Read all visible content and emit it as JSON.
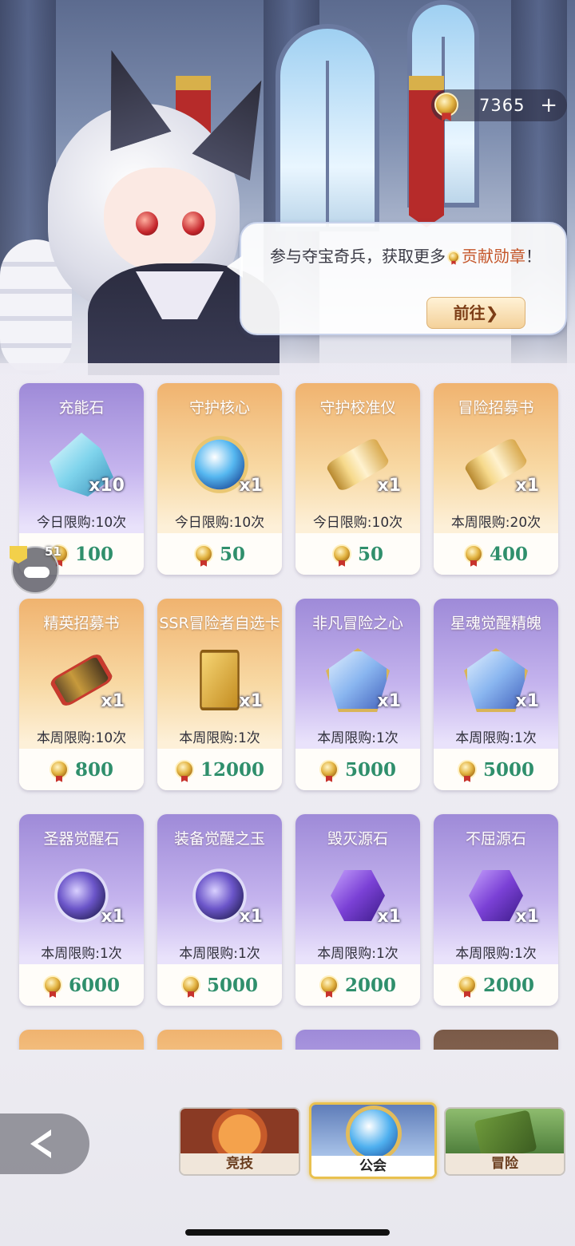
{
  "currency": {
    "icon": "contribution-medal-icon",
    "amount": "7365",
    "plus": "+"
  },
  "dialog": {
    "text_before": "参与夺宝奇兵，获取更多",
    "highlight": "贡献勋章",
    "text_after": "！",
    "button": "前往",
    "button_arrow": "❯"
  },
  "side": {
    "count": "51"
  },
  "items": [
    {
      "name": "充能石",
      "qty": "x10",
      "limit": "今日限购:10次",
      "price": "100",
      "theme": "purple",
      "icon": "crystal-icon"
    },
    {
      "name": "守护核心",
      "qty": "x1",
      "limit": "今日限购:10次",
      "price": "50",
      "theme": "orange",
      "icon": "orb-icon"
    },
    {
      "name": "守护校准仪",
      "qty": "x1",
      "limit": "今日限购:10次",
      "price": "50",
      "theme": "orange",
      "icon": "scroll-icon"
    },
    {
      "name": "冒险招募书",
      "qty": "x1",
      "limit": "本周限购:20次",
      "price": "400",
      "theme": "orange",
      "icon": "scroll-icon"
    },
    {
      "name": "精英招募书",
      "qty": "x1",
      "limit": "本周限购:10次",
      "price": "800",
      "theme": "orange",
      "icon": "red-scroll-icon"
    },
    {
      "name": "SSR冒险者自选卡",
      "qty": "x1",
      "limit": "本周限购:1次",
      "price": "12000",
      "theme": "orange",
      "icon": "card-icon"
    },
    {
      "name": "非凡冒险之心",
      "qty": "x1",
      "limit": "本周限购:1次",
      "price": "5000",
      "theme": "purple",
      "icon": "heart-badge-icon"
    },
    {
      "name": "星魂觉醒精魄",
      "qty": "x1",
      "limit": "本周限购:1次",
      "price": "5000",
      "theme": "purple",
      "icon": "badge-icon"
    },
    {
      "name": "圣器觉醒石",
      "qty": "x1",
      "limit": "本周限购:1次",
      "price": "6000",
      "theme": "purple",
      "icon": "galaxy-orb-icon"
    },
    {
      "name": "装备觉醒之玉",
      "qty": "x1",
      "limit": "本周限购:1次",
      "price": "5000",
      "theme": "purple",
      "icon": "jade-orb-icon"
    },
    {
      "name": "毁灭源石",
      "qty": "x1",
      "limit": "本周限购:1次",
      "price": "2000",
      "theme": "purple",
      "icon": "hex-stone-icon"
    },
    {
      "name": "不屈源石",
      "qty": "x1",
      "limit": "本周限购:1次",
      "price": "2000",
      "theme": "purple",
      "icon": "hex-stone-icon"
    }
  ],
  "nav": {
    "tabs": [
      {
        "label": "竞技",
        "active": false
      },
      {
        "label": "公会",
        "active": true
      },
      {
        "label": "冒险",
        "active": false
      }
    ]
  }
}
